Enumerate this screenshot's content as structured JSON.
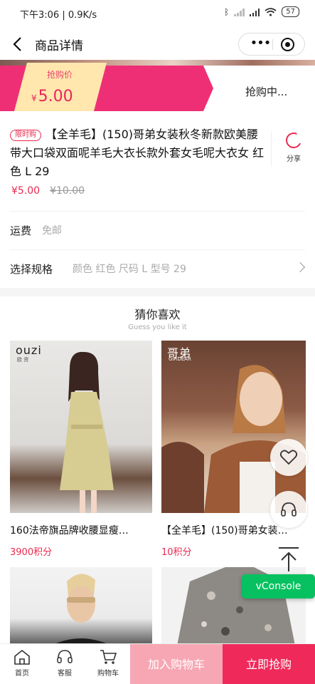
{
  "status_bar": {
    "time_speed": "下午3:06 | 0.9K/s",
    "battery": "57"
  },
  "nav": {
    "title": "商品详情",
    "menu_label": "•••"
  },
  "flash_sale": {
    "tag_label": "抢购价",
    "currency": "¥",
    "price": "5.00",
    "status": "抢购中..."
  },
  "product": {
    "badge": "限时购",
    "title": "【全羊毛】(150)哥弟女装秋冬新款欧美腰带大口袋双面呢羊毛大衣长款外套女毛呢大衣女 红色 L 29",
    "price": "¥5.00",
    "original_price": "¥10.00",
    "share_label": "分享",
    "shipping_label": "运费",
    "shipping_value": "免邮",
    "spec_label": "选择规格",
    "spec_value": "颜色 红色 尺码 L 型号 29"
  },
  "recommend": {
    "title": "猜你喜欢",
    "subtitle": "Guess you like it",
    "items": [
      {
        "name": "160法帝旗品牌收腰显瘦…",
        "points": "3900积分",
        "brand": "ouzi",
        "brand_sub": "欧 资"
      },
      {
        "name": "【全羊毛】(150)哥弟女装…",
        "points": "10积分",
        "brand": "哥弟",
        "brand_sub": "GIRDEAR"
      },
      {
        "name": "",
        "points": ""
      },
      {
        "name": "",
        "points": ""
      }
    ]
  },
  "floating": {
    "vconsole": "vConsole"
  },
  "bottom_bar": {
    "tabs": [
      "首页",
      "客服",
      "购物车"
    ],
    "add_to_cart": "加入购物车",
    "buy_now": "立即抢购"
  },
  "colors": {
    "accent": "#ef2a5a",
    "flash_pink": "#ef2f75",
    "tag_yellow": "#ffe7ad",
    "add_cart": "#f7a7b3",
    "vconsole_green": "#07c160"
  }
}
